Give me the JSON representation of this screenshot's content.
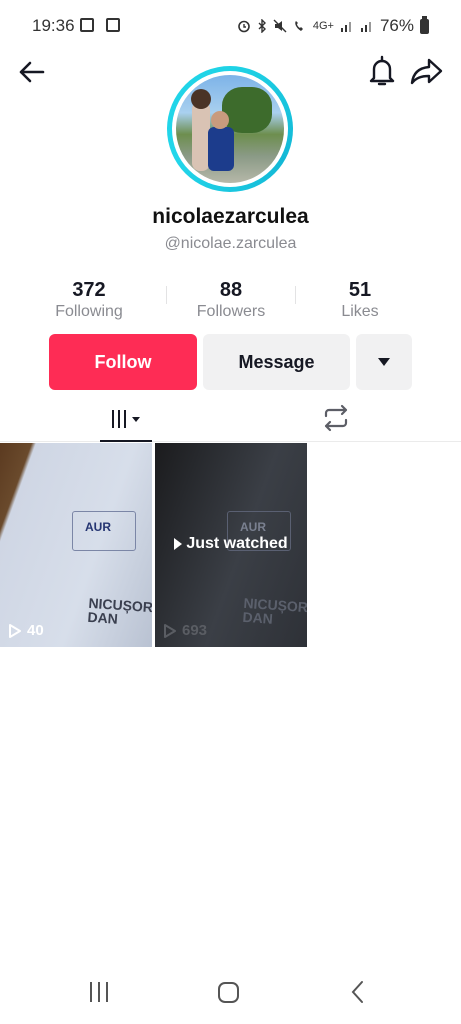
{
  "status_bar": {
    "time": "19:36",
    "network": "4G+",
    "battery": "76%"
  },
  "profile": {
    "username": "nicolaezarculea",
    "handle": "@nicolae.zarculea"
  },
  "stats": [
    {
      "value": "372",
      "label": "Following"
    },
    {
      "value": "88",
      "label": "Followers"
    },
    {
      "value": "51",
      "label": "Likes"
    }
  ],
  "actions": {
    "follow_label": "Follow",
    "message_label": "Message"
  },
  "videos": [
    {
      "views": "40",
      "doc_text": "AUR",
      "doc_name": "NICUȘOR\nDAN"
    },
    {
      "views": "693",
      "overlay": "Just watched",
      "doc_text": "AUR",
      "doc_name": "NICUȘOR\nDAN"
    }
  ],
  "colors": {
    "follow_bg": "#fe2c55",
    "avatar_ring": "#1fd3e6",
    "secondary_btn": "#f1f1f2"
  }
}
